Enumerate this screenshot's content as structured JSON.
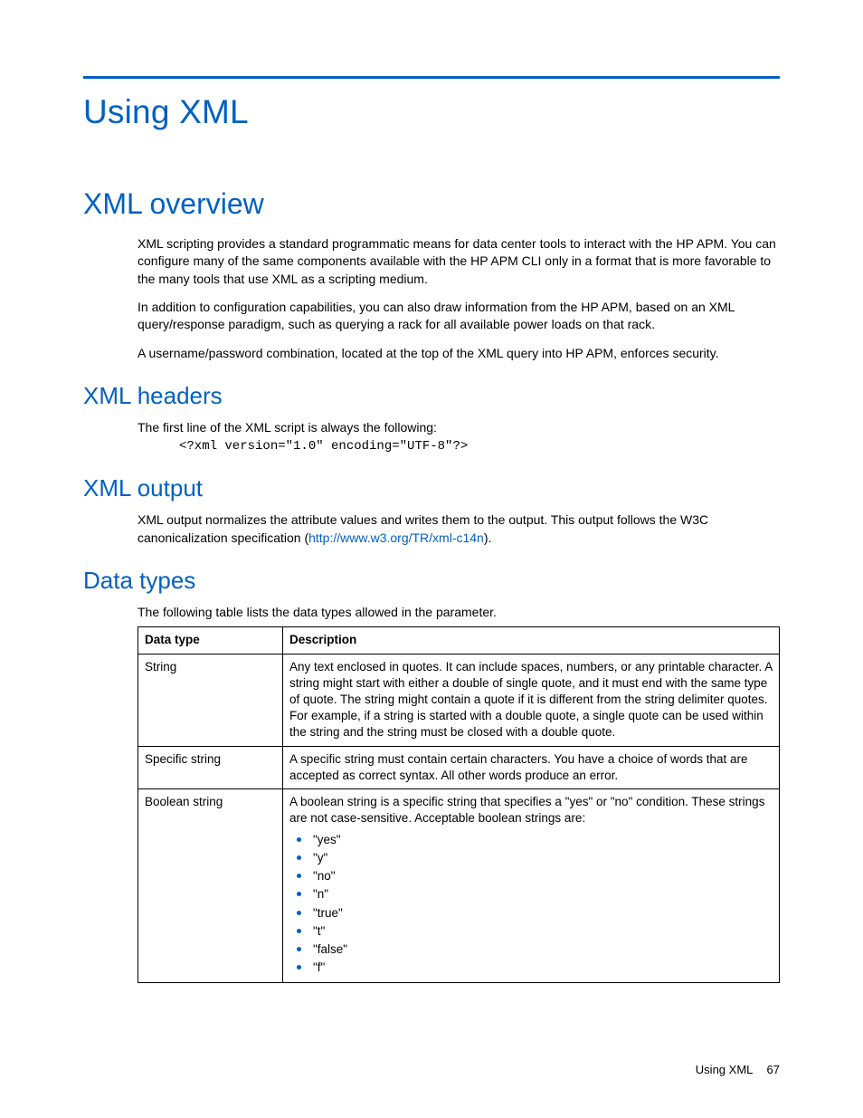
{
  "chapter_title": "Using XML",
  "sections": {
    "overview": {
      "heading": "XML overview",
      "p1": "XML scripting provides a standard programmatic means for data center tools to interact with the HP APM. You can configure many of the same components available with the HP APM CLI only in a format that is more favorable to the many tools that use XML as a scripting medium.",
      "p2": "In addition to configuration capabilities, you can also draw information from the HP APM, based on an XML query/response paradigm, such as querying a rack for all available power loads on that rack.",
      "p3": "A username/password combination, located at the top of the XML query into HP APM, enforces security."
    },
    "headers": {
      "heading": "XML headers",
      "intro": "The first line of the XML script is always the following:",
      "code": "<?xml version=\"1.0\" encoding=\"UTF-8\"?>"
    },
    "output": {
      "heading": "XML output",
      "p_before_link": "XML output normalizes the attribute values and writes them to the output. This output follows the W3C canonicalization specification (",
      "link_text": "http://www.w3.org/TR/xml-c14n",
      "p_after_link": ")."
    },
    "datatypes": {
      "heading": "Data types",
      "intro": "The following table lists the data types allowed in the parameter.",
      "columns": {
        "c1": "Data type",
        "c2": "Description"
      },
      "rows": [
        {
          "name": "String",
          "desc_p1": "Any text enclosed in quotes. It can include spaces, numbers, or any printable character. A string might start with either a double of single quote, and it must end with the same type of quote. The string might contain a quote if it is different from the string delimiter quotes.",
          "desc_p2": "For example, if a string is started with a double quote, a single quote can be used within the string and the string must be closed with a double quote."
        },
        {
          "name": "Specific string",
          "desc_p1": "A specific string must contain certain characters. You have a choice of words that are accepted as correct syntax. All other words produce an error."
        },
        {
          "name": "Boolean string",
          "desc_p1": "A boolean string is a specific string that specifies a \"yes\" or \"no\" condition. These strings are not case-sensitive. Acceptable boolean strings are:",
          "bullets": [
            "\"yes\"",
            "\"y\"",
            "\"no\"",
            "\"n\"",
            "\"true\"",
            "\"t\"",
            "\"false\"",
            "\"f\""
          ]
        }
      ]
    }
  },
  "footer": {
    "label": "Using XML",
    "page": "67"
  }
}
